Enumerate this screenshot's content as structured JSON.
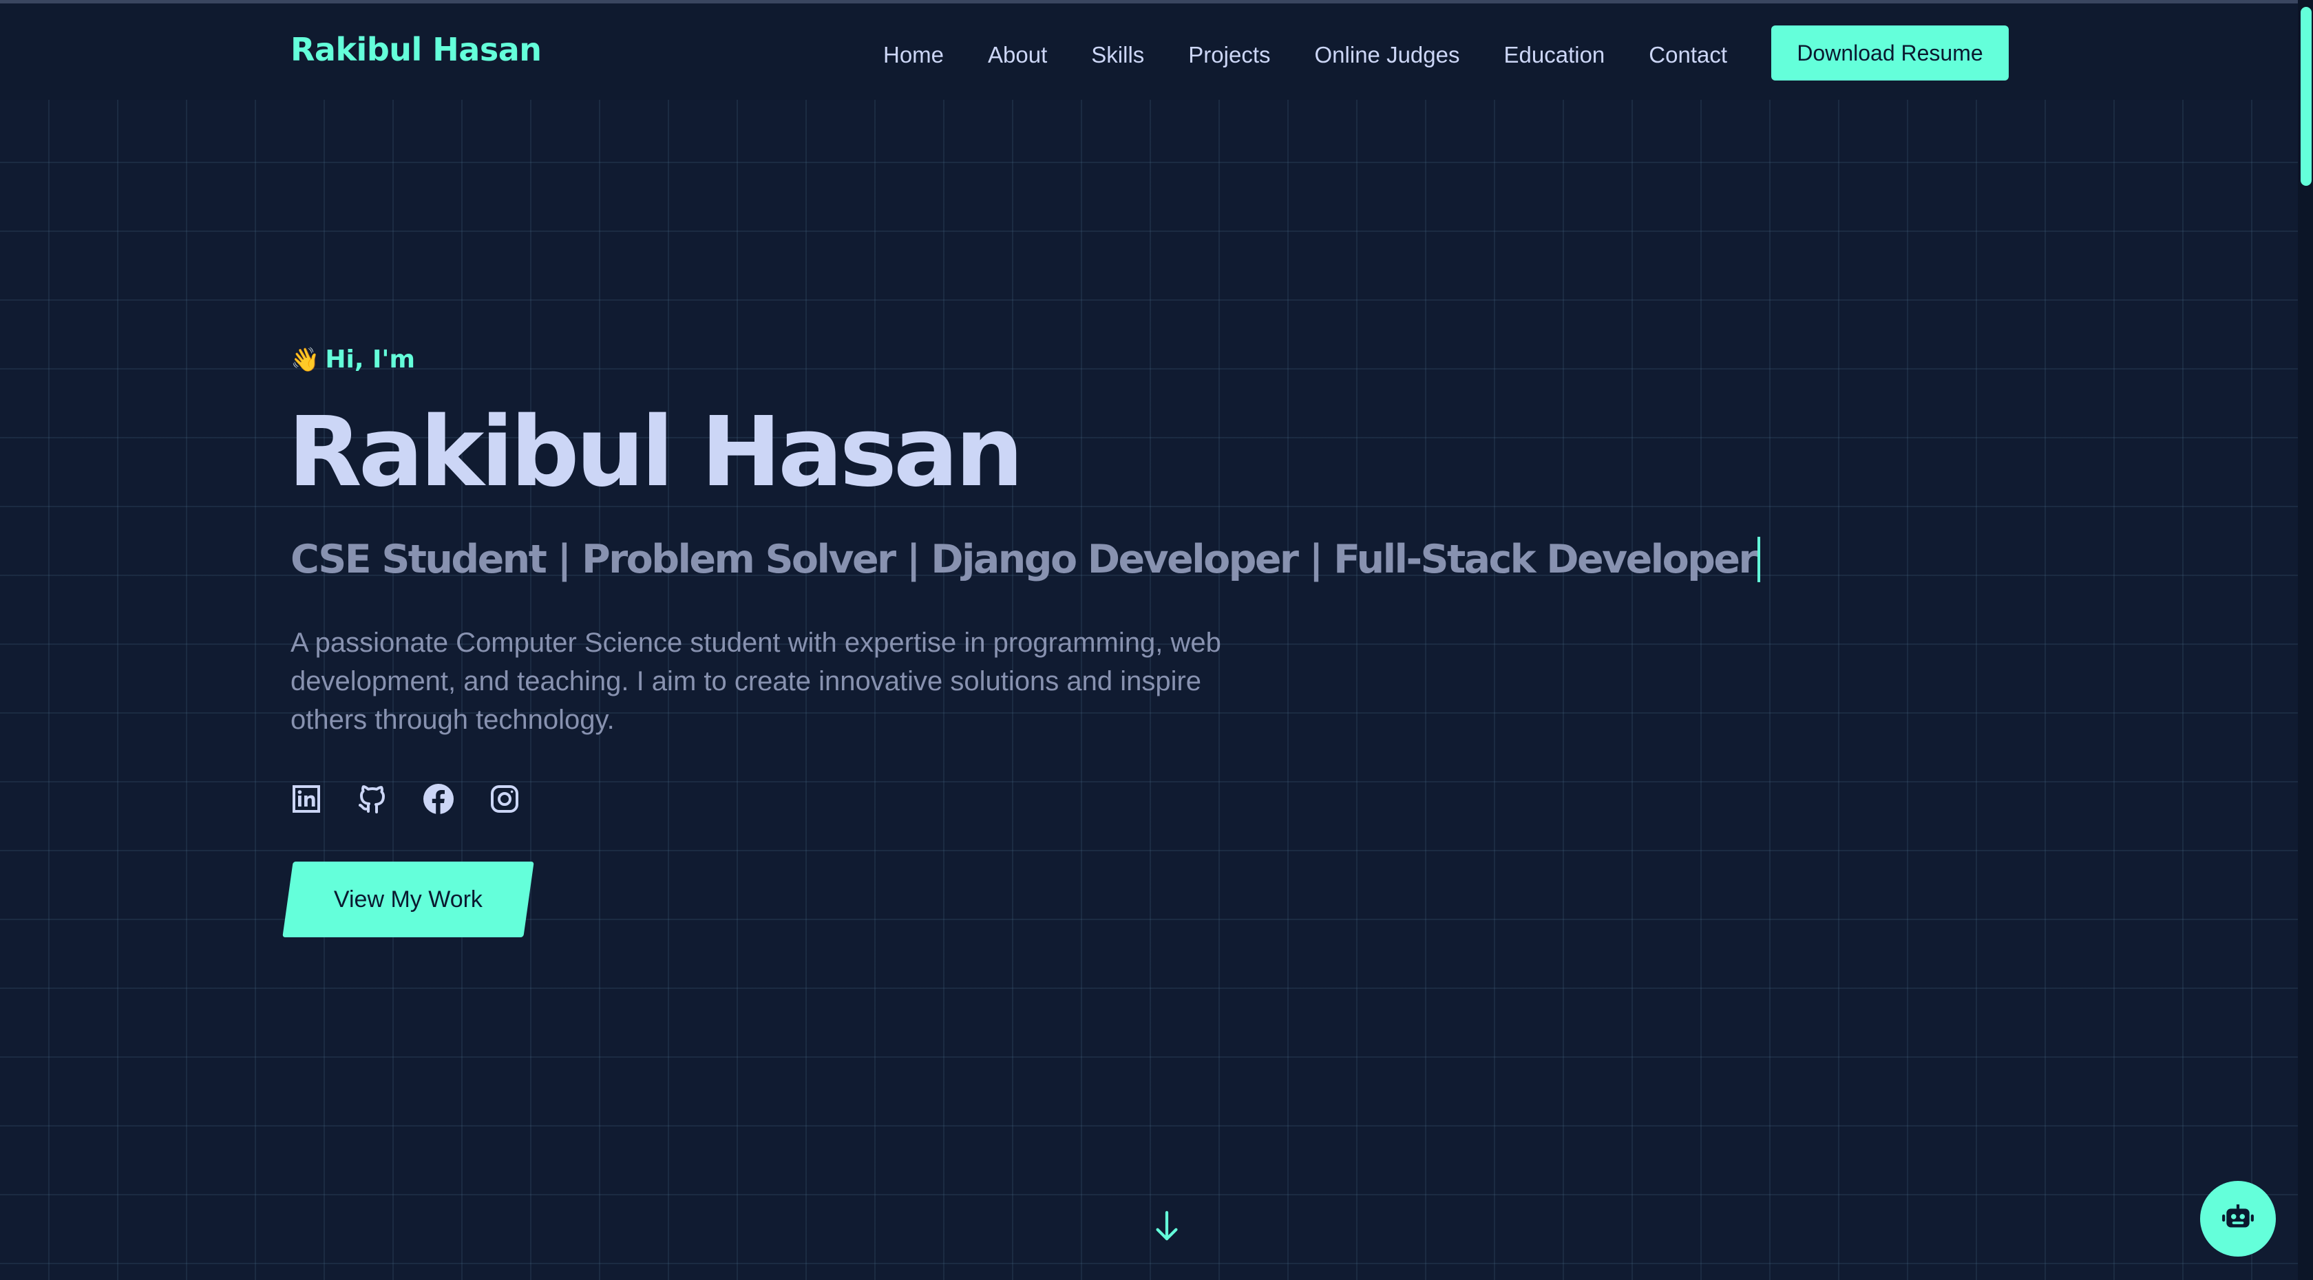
{
  "brand": {
    "name": "Rakibul Hasan"
  },
  "nav": {
    "links": [
      "Home",
      "About",
      "Skills",
      "Projects",
      "Online Judges",
      "Education",
      "Contact"
    ],
    "resume_label": "Download Resume"
  },
  "hero": {
    "greeting": "Hi, I'm",
    "greeting_icon": "waving-hand-icon",
    "name": "Rakibul Hasan",
    "roles": "CSE Student | Problem Solver | Django Developer | Full-Stack Developer",
    "description": "A passionate Computer Science student with expertise in programming, web development, and teaching. I aim to create innovative solutions and inspire others through technology.",
    "cta_label": "View My Work"
  },
  "socials": [
    {
      "icon": "linkedin-icon"
    },
    {
      "icon": "github-icon"
    },
    {
      "icon": "facebook-icon"
    },
    {
      "icon": "instagram-icon"
    }
  ],
  "colors": {
    "accent": "#64ffda",
    "background": "#101b31",
    "heading": "#ccd6f6",
    "muted": "#8892b0"
  }
}
